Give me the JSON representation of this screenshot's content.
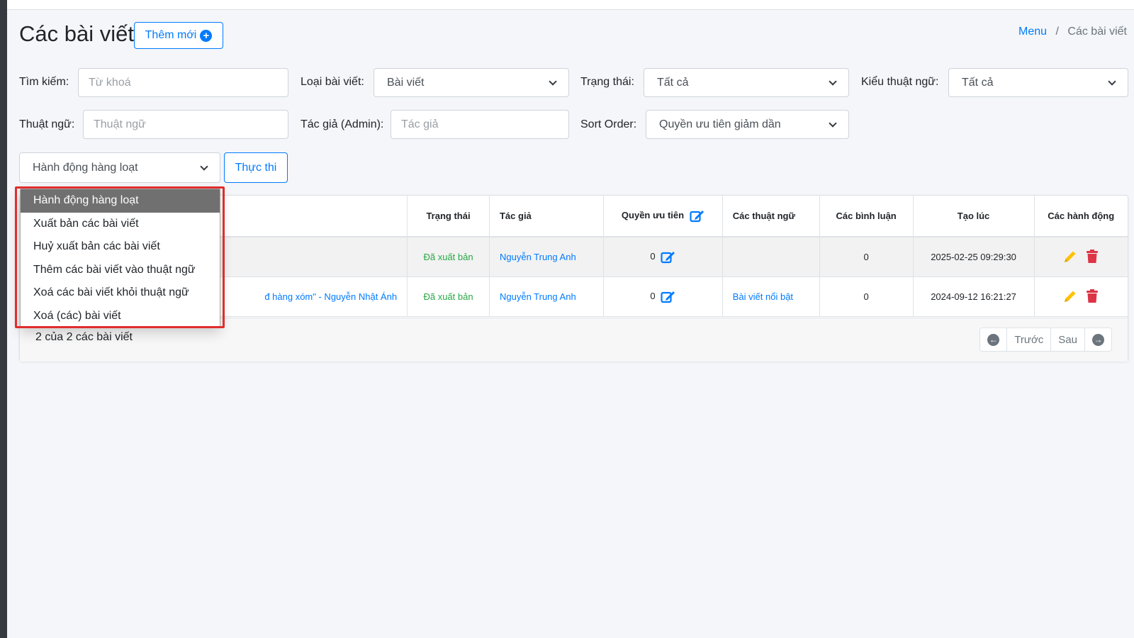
{
  "header": {
    "title": "Các bài viết",
    "add_button": "Thêm mới",
    "breadcrumb": {
      "menu": "Menu",
      "separator": "/",
      "current": "Các bài viết"
    }
  },
  "filters": {
    "search_label": "Tìm kiếm:",
    "search_placeholder": "Từ khoá",
    "post_type_label": "Loại bài viết:",
    "post_type_value": "Bài viết",
    "status_label": "Trạng thái:",
    "status_value": "Tất cả",
    "term_type_label": "Kiểu thuật ngữ:",
    "term_type_value": "Tất cả",
    "term_label": "Thuật ngữ:",
    "term_placeholder": "Thuật ngữ",
    "author_label": "Tác giả (Admin):",
    "author_placeholder": "Tác giả",
    "sort_label": "Sort Order:",
    "sort_value": "Quyền ưu tiên giảm dần"
  },
  "bulk": {
    "select_value": "Hành động hàng loạt",
    "run_button": "Thực thi",
    "options": [
      "Hành động hàng loạt",
      "Xuất bản các bài viết",
      "Huỷ xuất bản các bài viết",
      "Thêm các bài viết vào thuật ngữ",
      "Xoá các bài viết khỏi thuật ngữ",
      "Xoá (các) bài viết"
    ],
    "selected_index": 0
  },
  "table": {
    "columns": {
      "status": "Trạng thái",
      "author": "Tác giả",
      "priority": "Quyền ưu tiên",
      "terms": "Các thuật ngữ",
      "comments": "Các bình luận",
      "created": "Tạo lúc",
      "actions": "Các hành động"
    },
    "rows": [
      {
        "title": "",
        "status": "Đã xuất bản",
        "author": "Nguyễn Trung Anh",
        "priority": "0",
        "terms": "",
        "comments": "0",
        "created": "2025-02-25 09:29:30"
      },
      {
        "title": "đ hàng xóm\" - Nguyễn Nhật Ánh",
        "status": "Đã xuất bản",
        "author": "Nguyễn Trung Anh",
        "priority": "0",
        "terms": "Bài viết nổi bật",
        "comments": "0",
        "created": "2024-09-12 16:21:27"
      }
    ]
  },
  "footer": {
    "count_text": "2 của 2 các bài viết",
    "prev": "Trước",
    "next": "Sau"
  },
  "colors": {
    "primary": "#007bff",
    "success": "#28a745",
    "danger": "#dc3545",
    "warning": "#ffc107",
    "highlight": "#e02d2d"
  },
  "icons": [
    "plus-circle-icon",
    "chevron-down-icon",
    "edit-square-icon",
    "pencil-icon",
    "trash-icon",
    "arrow-left-circle-icon",
    "arrow-right-circle-icon"
  ]
}
